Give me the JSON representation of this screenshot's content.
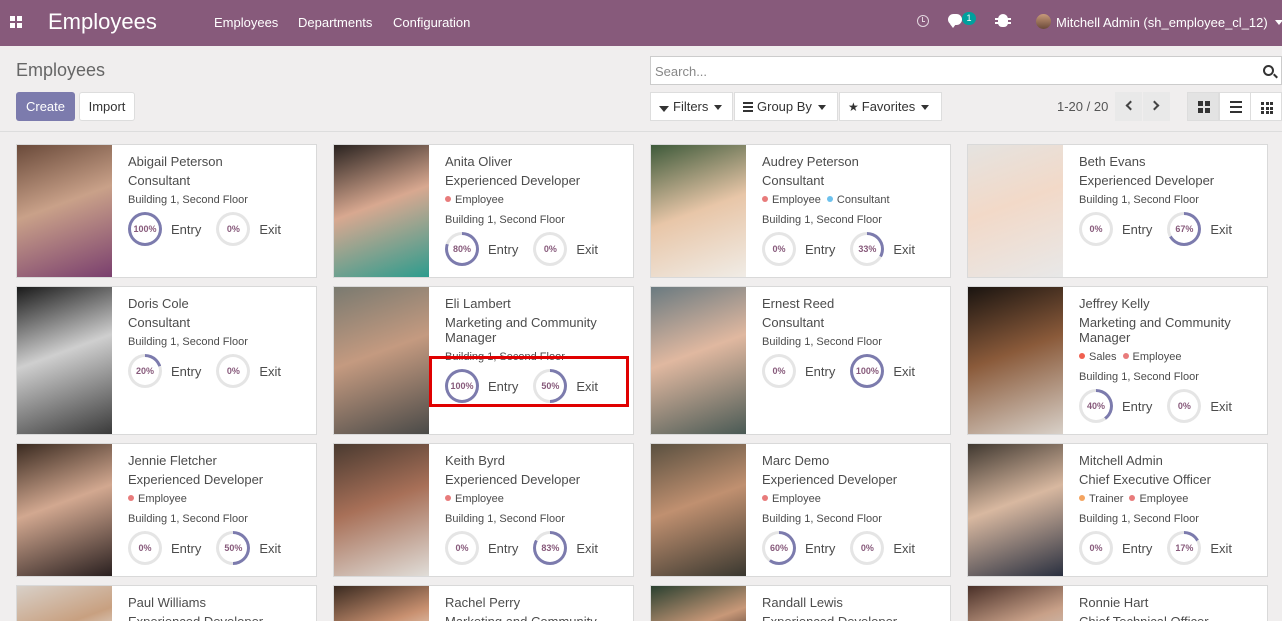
{
  "navbar": {
    "app_title": "Employees",
    "menu": [
      "Employees",
      "Departments",
      "Configuration"
    ],
    "chat_count": "1",
    "user": "Mitchell Admin (sh_employee_cl_12)"
  },
  "control": {
    "breadcrumb": "Employees",
    "create": "Create",
    "import": "Import",
    "search_placeholder": "Search...",
    "filters": "Filters",
    "group_by": "Group By",
    "favorites": "Favorites",
    "pager": "1-20 / 20"
  },
  "labels": {
    "entry": "Entry",
    "exit": "Exit"
  },
  "colors": {
    "primary": "#875a7b",
    "accent": "#7c7bad",
    "gauge_fill": "#7c7bad",
    "gauge_track": "#e5e5e5"
  },
  "employees": [
    {
      "name": "Abigail Peterson",
      "job": "Consultant",
      "tags": [],
      "location": "Building 1, Second Floor",
      "entry": "100%",
      "exit": "0%"
    },
    {
      "name": "Anita Oliver",
      "job": "Experienced Developer",
      "tags": [
        {
          "label": "Employee",
          "color": "#e87b7b"
        }
      ],
      "location": "Building 1, Second Floor",
      "entry": "80%",
      "exit": "0%"
    },
    {
      "name": "Audrey Peterson",
      "job": "Consultant",
      "tags": [
        {
          "label": "Employee",
          "color": "#e87b7b"
        },
        {
          "label": "Consultant",
          "color": "#6cc1ed"
        }
      ],
      "location": "Building 1, Second Floor",
      "entry": "0%",
      "exit": "33%"
    },
    {
      "name": "Beth Evans",
      "job": "Experienced Developer",
      "tags": [],
      "location": "Building 1, Second Floor",
      "entry": "0%",
      "exit": "67%"
    },
    {
      "name": "Doris Cole",
      "job": "Consultant",
      "tags": [],
      "location": "Building 1, Second Floor",
      "entry": "20%",
      "exit": "0%"
    },
    {
      "name": "Eli Lambert",
      "job": "Marketing and Community Manager",
      "tags": [],
      "location": "Building 1, Second Floor",
      "entry": "100%",
      "exit": "50%"
    },
    {
      "name": "Ernest Reed",
      "job": "Consultant",
      "tags": [],
      "location": "Building 1, Second Floor",
      "entry": "0%",
      "exit": "100%"
    },
    {
      "name": "Jeffrey Kelly",
      "job": "Marketing and Community Manager",
      "tags": [
        {
          "label": "Sales",
          "color": "#f06050"
        },
        {
          "label": "Employee",
          "color": "#e87b7b"
        }
      ],
      "location": "Building 1, Second Floor",
      "entry": "40%",
      "exit": "0%"
    },
    {
      "name": "Jennie Fletcher",
      "job": "Experienced Developer",
      "tags": [
        {
          "label": "Employee",
          "color": "#e87b7b"
        }
      ],
      "location": "Building 1, Second Floor",
      "entry": "0%",
      "exit": "50%"
    },
    {
      "name": "Keith Byrd",
      "job": "Experienced Developer",
      "tags": [
        {
          "label": "Employee",
          "color": "#e87b7b"
        }
      ],
      "location": "Building 1, Second Floor",
      "entry": "0%",
      "exit": "83%"
    },
    {
      "name": "Marc Demo",
      "job": "Experienced Developer",
      "tags": [
        {
          "label": "Employee",
          "color": "#e87b7b"
        }
      ],
      "location": "Building 1, Second Floor",
      "entry": "60%",
      "exit": "0%"
    },
    {
      "name": "Mitchell Admin",
      "job": "Chief Executive Officer",
      "tags": [
        {
          "label": "Trainer",
          "color": "#f4a460"
        },
        {
          "label": "Employee",
          "color": "#e87b7b"
        }
      ],
      "location": "Building 1, Second Floor",
      "entry": "0%",
      "exit": "17%"
    },
    {
      "name": "Paul Williams",
      "job": "Experienced Developer",
      "tags": [],
      "location": "",
      "entry": "",
      "exit": ""
    },
    {
      "name": "Rachel Perry",
      "job": "Marketing and Community",
      "tags": [],
      "location": "",
      "entry": "",
      "exit": ""
    },
    {
      "name": "Randall Lewis",
      "job": "Experienced Developer",
      "tags": [],
      "location": "",
      "entry": "",
      "exit": ""
    },
    {
      "name": "Ronnie Hart",
      "job": "Chief Technical Officer",
      "tags": [],
      "location": "",
      "entry": "",
      "exit": ""
    }
  ]
}
